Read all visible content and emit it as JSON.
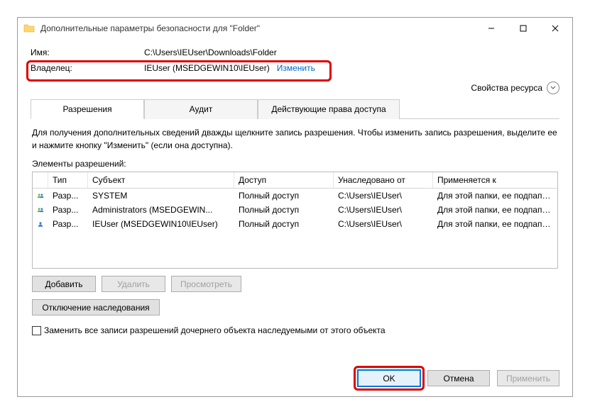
{
  "title": "Дополнительные параметры безопасности для \"Folder\"",
  "name_label": "Имя:",
  "name_value": "C:\\Users\\IEUser\\Downloads\\Folder",
  "owner_label": "Владелец:",
  "owner_value": "IEUser (MSEDGEWIN10\\IEUser)",
  "change_link": "Изменить",
  "resource_props": "Свойства ресурса",
  "tabs": {
    "permissions": "Разрешения",
    "audit": "Аудит",
    "effective": "Действующие права доступа"
  },
  "instructions": "Для получения дополнительных сведений дважды щелкните запись разрешения. Чтобы изменить запись разрешения, выделите ее и нажмите кнопку \"Изменить\" (если она доступна).",
  "entries_label": "Элементы разрешений:",
  "columns": {
    "type": "Тип",
    "subject": "Субъект",
    "access": "Доступ",
    "inherited": "Унаследовано от",
    "applies": "Применяется к"
  },
  "rows": [
    {
      "type": "Разр...",
      "subject": "SYSTEM",
      "access": "Полный доступ",
      "inherited": "C:\\Users\\IEUser\\",
      "applies": "Для этой папки, ее подпапок ..."
    },
    {
      "type": "Разр...",
      "subject": "Administrators (MSEDGEWIN...",
      "access": "Полный доступ",
      "inherited": "C:\\Users\\IEUser\\",
      "applies": "Для этой папки, ее подпапок ..."
    },
    {
      "type": "Разр...",
      "subject": "IEUser (MSEDGEWIN10\\IEUser)",
      "access": "Полный доступ",
      "inherited": "C:\\Users\\IEUser\\",
      "applies": "Для этой папки, ее подпапок ..."
    }
  ],
  "buttons": {
    "add": "Добавить",
    "remove": "Удалить",
    "view": "Просмотреть",
    "disable_inh": "Отключение наследования",
    "ok": "OK",
    "cancel": "Отмена",
    "apply": "Применить"
  },
  "replace_check": "Заменить все записи разрешений дочернего объекта наследуемыми от этого объекта"
}
